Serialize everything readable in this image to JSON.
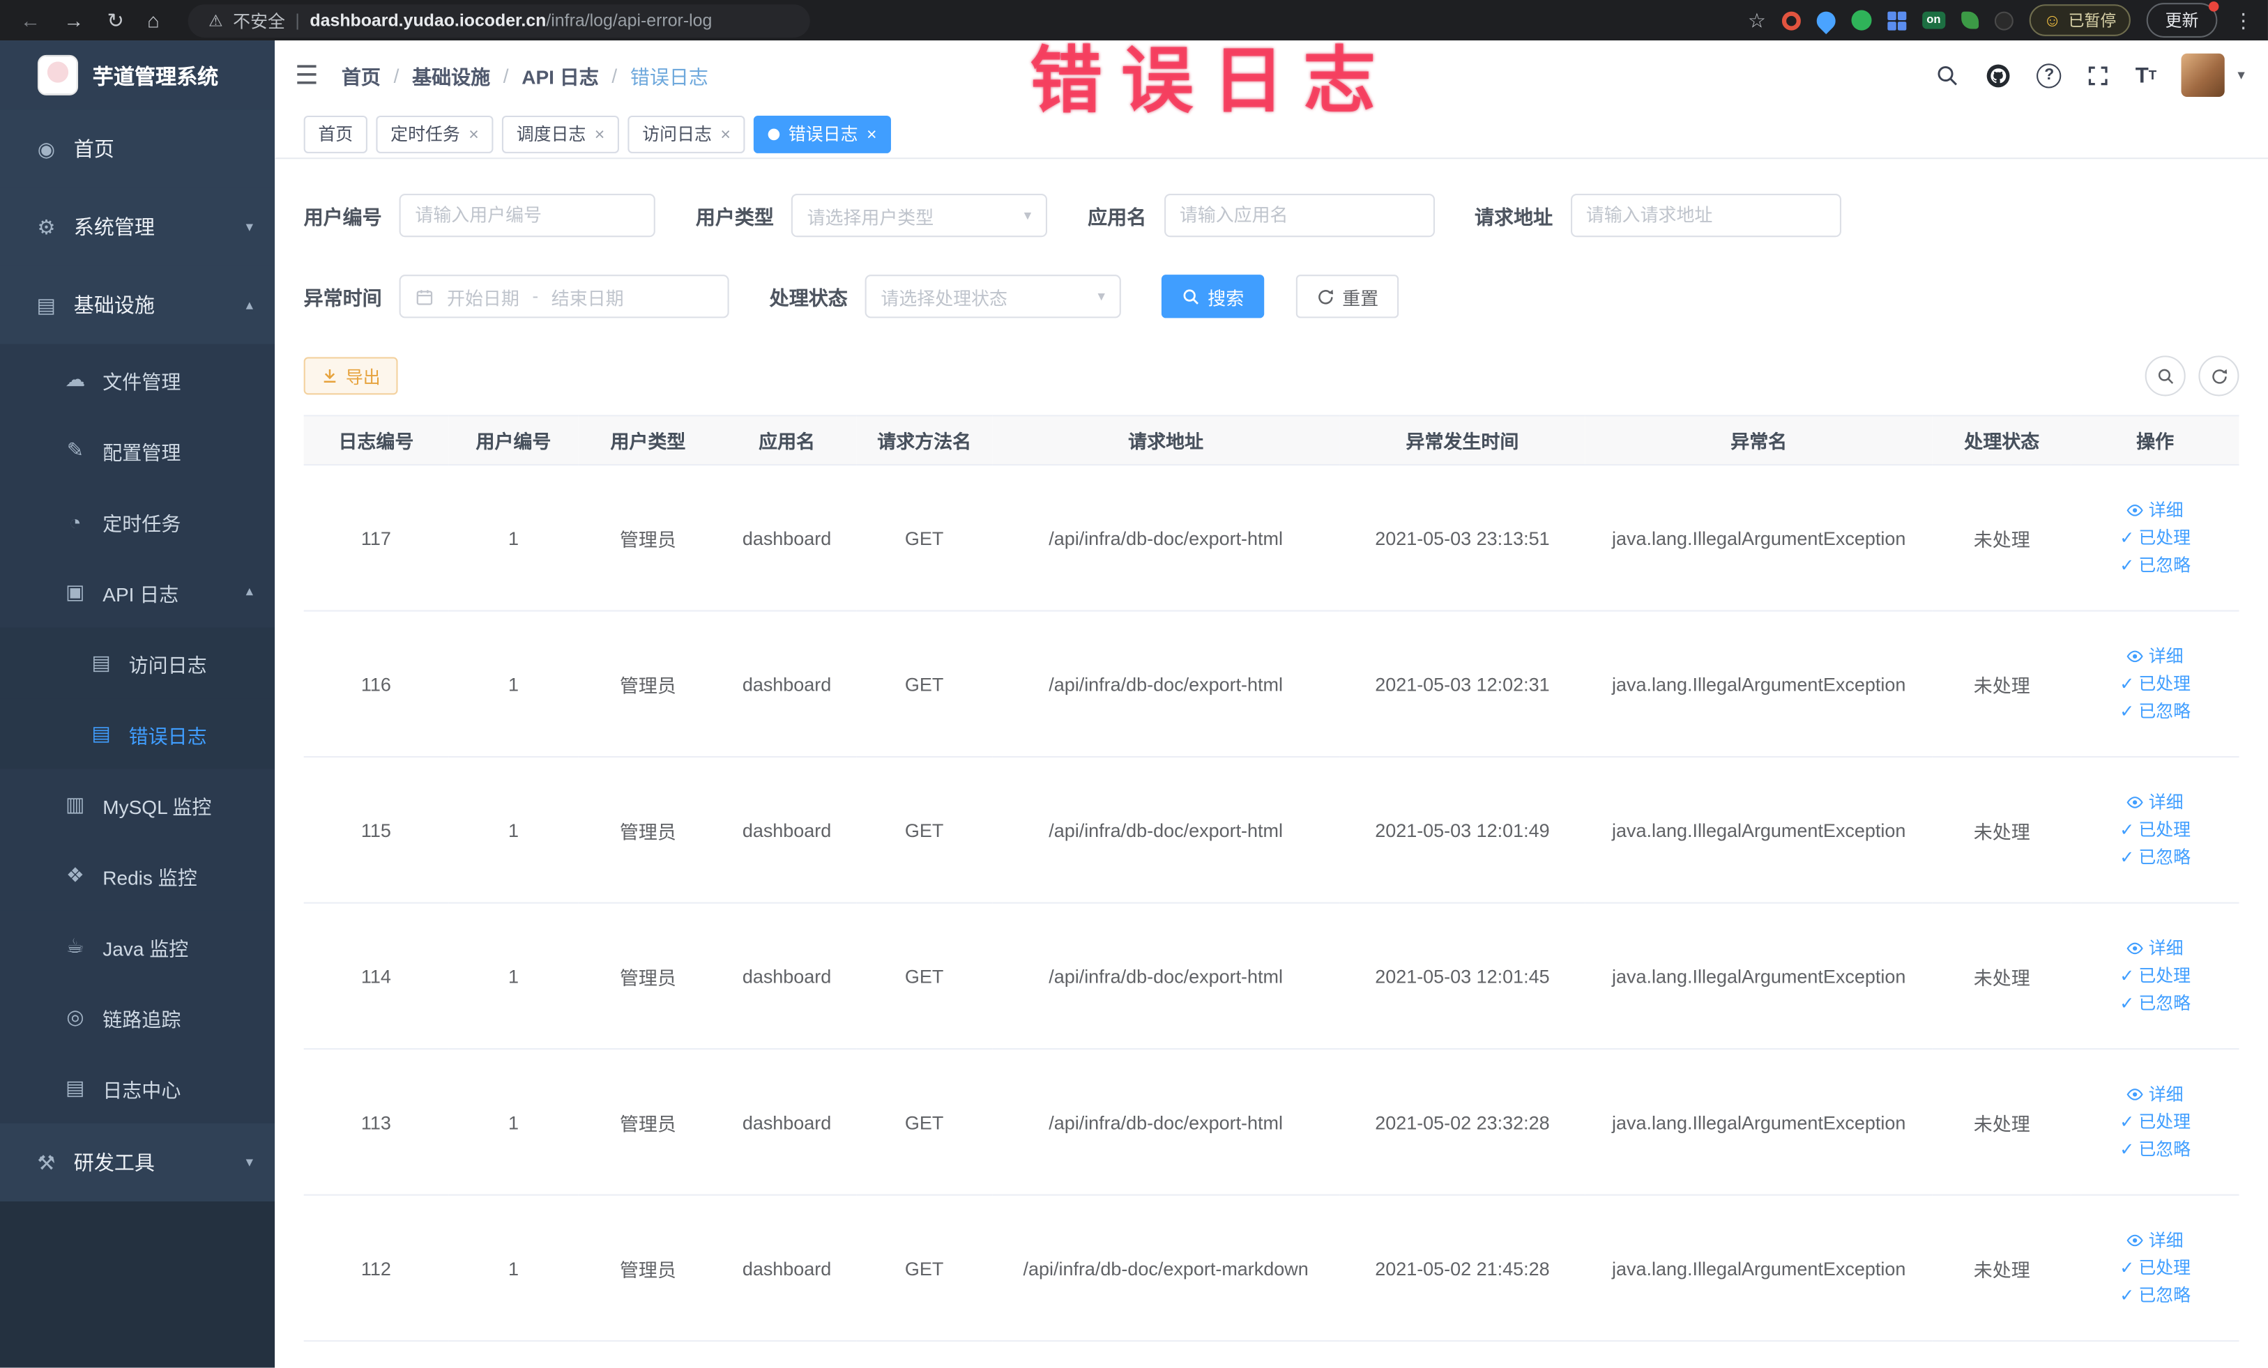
{
  "browser": {
    "security_label": "不安全",
    "url_domain": "dashboard.yudao.iocoder.cn",
    "url_path": "/infra/log/api-error-log",
    "extension_on_label": "on",
    "paused_badge": "已暂停",
    "update_button": "更新"
  },
  "watermark": "错误日志",
  "icons": {
    "back": "←",
    "forward": "→",
    "reload": "↻",
    "home": "⌂",
    "warning_triangle": "⚠",
    "pipe": "|",
    "star": "☆",
    "smiley": "☺",
    "kebab": "⋮",
    "hamburger": "☰",
    "question": "?",
    "caret_down": "▾",
    "check": "✓",
    "close": "×",
    "font_large": "T",
    "font_small": "T"
  },
  "sidebar": {
    "logo_title": "芋道管理系统",
    "items": [
      {
        "label": "首页",
        "glyph": "◉",
        "arrow": ""
      },
      {
        "label": "系统管理",
        "glyph": "⚙",
        "arrow": "▾"
      },
      {
        "label": "基础设施",
        "glyph": "▤",
        "arrow": "▴"
      },
      {
        "label": "文件管理",
        "glyph": "☁",
        "arrow": ""
      },
      {
        "label": "配置管理",
        "glyph": "✎",
        "arrow": ""
      },
      {
        "label": "定时任务",
        "glyph": "◔",
        "arrow": ""
      },
      {
        "label": "API 日志",
        "glyph": "▣",
        "arrow": "▴"
      },
      {
        "label": "访问日志",
        "glyph": "▤",
        "arrow": ""
      },
      {
        "label": "错误日志",
        "glyph": "▤",
        "arrow": ""
      },
      {
        "label": "MySQL 监控",
        "glyph": "▥",
        "arrow": ""
      },
      {
        "label": "Redis 监控",
        "glyph": "❖",
        "arrow": ""
      },
      {
        "label": "Java 监控",
        "glyph": "☕",
        "arrow": ""
      },
      {
        "label": "链路追踪",
        "glyph": "◎",
        "arrow": ""
      },
      {
        "label": "日志中心",
        "glyph": "▤",
        "arrow": ""
      },
      {
        "label": "研发工具",
        "glyph": "⚒",
        "arrow": "▾"
      }
    ]
  },
  "breadcrumb": {
    "separator": "/",
    "items": [
      "首页",
      "基础设施",
      "API 日志",
      "错误日志"
    ]
  },
  "tabs": [
    {
      "label": "首页"
    },
    {
      "label": "定时任务"
    },
    {
      "label": "调度日志"
    },
    {
      "label": "访问日志"
    },
    {
      "label": "错误日志"
    }
  ],
  "filters": {
    "user_id": {
      "label": "用户编号",
      "placeholder": "请输入用户编号"
    },
    "user_type": {
      "label": "用户类型",
      "placeholder": "请选择用户类型"
    },
    "app_name": {
      "label": "应用名",
      "placeholder": "请输入应用名"
    },
    "request_url": {
      "label": "请求地址",
      "placeholder": "请输入请求地址"
    },
    "exception_time": {
      "label": "异常时间",
      "start_placeholder": "开始日期",
      "separator": "-",
      "end_placeholder": "结束日期"
    },
    "process_status": {
      "label": "处理状态",
      "placeholder": "请选择处理状态"
    },
    "search_button": "搜索",
    "reset_button": "重置"
  },
  "toolbar": {
    "export_button": "导出"
  },
  "table": {
    "columns": [
      "日志编号",
      "用户编号",
      "用户类型",
      "应用名",
      "请求方法名",
      "请求地址",
      "异常发生时间",
      "异常名",
      "处理状态",
      "操作"
    ],
    "actions": [
      "详细",
      "已处理",
      "已忽略"
    ],
    "rows": [
      {
        "id": "117",
        "user_id": "1",
        "user_type": "管理员",
        "app": "dashboard",
        "method": "GET",
        "url": "/api/infra/db-doc/export-html",
        "time": "2021-05-03 23:13:51",
        "exception": "java.lang.IllegalArgumentException",
        "status": "未处理"
      },
      {
        "id": "116",
        "user_id": "1",
        "user_type": "管理员",
        "app": "dashboard",
        "method": "GET",
        "url": "/api/infra/db-doc/export-html",
        "time": "2021-05-03 12:02:31",
        "exception": "java.lang.IllegalArgumentException",
        "status": "未处理"
      },
      {
        "id": "115",
        "user_id": "1",
        "user_type": "管理员",
        "app": "dashboard",
        "method": "GET",
        "url": "/api/infra/db-doc/export-html",
        "time": "2021-05-03 12:01:49",
        "exception": "java.lang.IllegalArgumentException",
        "status": "未处理"
      },
      {
        "id": "114",
        "user_id": "1",
        "user_type": "管理员",
        "app": "dashboard",
        "method": "GET",
        "url": "/api/infra/db-doc/export-html",
        "time": "2021-05-03 12:01:45",
        "exception": "java.lang.IllegalArgumentException",
        "status": "未处理"
      },
      {
        "id": "113",
        "user_id": "1",
        "user_type": "管理员",
        "app": "dashboard",
        "method": "GET",
        "url": "/api/infra/db-doc/export-html",
        "time": "2021-05-02 23:32:28",
        "exception": "java.lang.IllegalArgumentException",
        "status": "未处理"
      },
      {
        "id": "112",
        "user_id": "1",
        "user_type": "管理员",
        "app": "dashboard",
        "method": "GET",
        "url": "/api/infra/db-doc/export-markdown",
        "time": "2021-05-02 21:45:28",
        "exception": "java.lang.IllegalArgumentException",
        "status": "未处理"
      }
    ]
  }
}
